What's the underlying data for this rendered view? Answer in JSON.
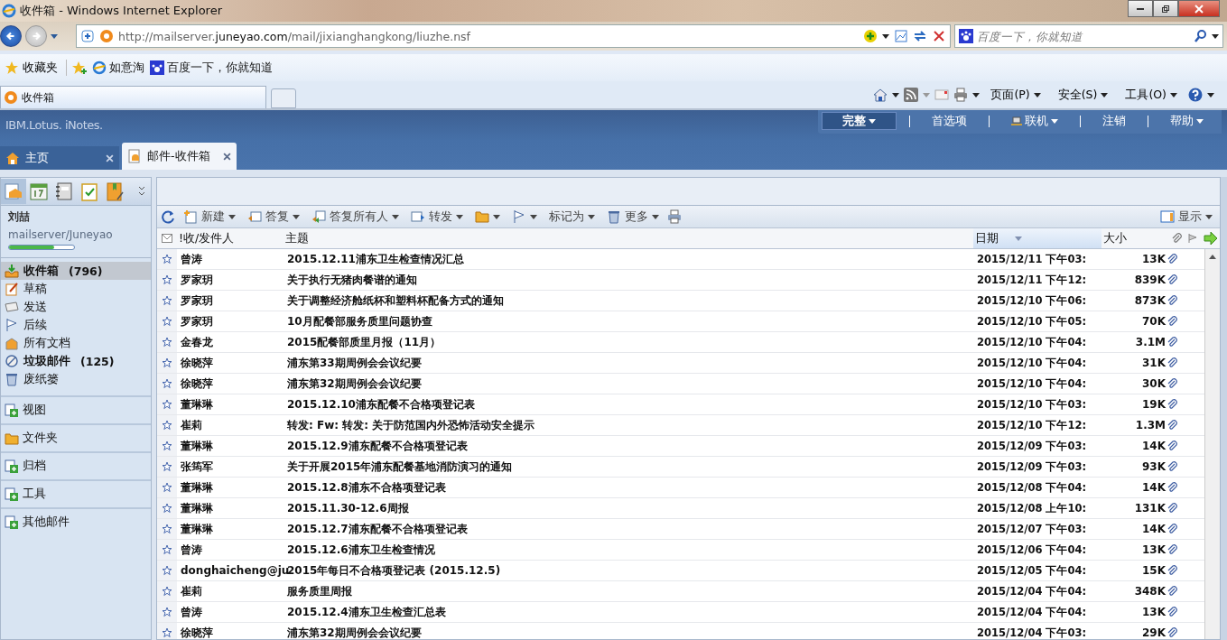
{
  "window": {
    "title": "收件箱 - Windows Internet Explorer"
  },
  "address_bar": {
    "url_prefix": "http://mailserver.",
    "url_domain": "juneyao.com",
    "url_path": "/mail/jixianghangkong/liuzhe.nsf"
  },
  "search": {
    "placeholder": "百度一下，你就知道"
  },
  "favorites_bar": {
    "favorites": "收藏夹",
    "links": [
      "如意淘",
      "百度一下，你就知道"
    ]
  },
  "browser_tabs": [
    {
      "label": "收件箱",
      "selected": true
    }
  ],
  "command_bar": [
    "页面(P)",
    "安全(S)",
    "工具(O)"
  ],
  "app": {
    "logo": "IBM.Lotus. iNotes.",
    "nav": [
      {
        "label": "完整",
        "selected": true,
        "dropdown": true
      },
      {
        "label": "首选项",
        "selected": false,
        "dropdown": false
      },
      {
        "label": "联机",
        "selected": false,
        "dropdown": true
      },
      {
        "label": "注销",
        "selected": false,
        "dropdown": false
      },
      {
        "label": "帮助",
        "selected": false,
        "dropdown": true
      }
    ]
  },
  "app_tabs": [
    {
      "label": "主页",
      "selected": false
    },
    {
      "label": "邮件-收件箱",
      "selected": true
    }
  ],
  "sidebar": {
    "user": "刘喆",
    "server": "mailserver/Juneyao",
    "quota": {
      "level": 0.7
    },
    "folders": [
      {
        "label": "收件箱",
        "count": "(796)",
        "selected": true
      },
      {
        "label": "草稿",
        "selected": false
      },
      {
        "label": "发送",
        "selected": false
      },
      {
        "label": "后续",
        "selected": false
      },
      {
        "label": "所有文档",
        "selected": false
      },
      {
        "label": "垃圾邮件",
        "count": "(125)",
        "selected": false
      },
      {
        "label": "废纸篓",
        "selected": false
      }
    ],
    "sections": [
      "视图",
      "文件夹",
      "归档",
      "工具",
      "其他邮件"
    ]
  },
  "toolbar": {
    "new": "新建",
    "reply": "答复",
    "reply_all": "答复所有人",
    "forward": "转发",
    "mark_as": "标记为",
    "more": "更多",
    "display": "显示"
  },
  "table": {
    "columns": [
      "!收/发件人",
      "主题",
      "日期",
      "大小"
    ],
    "rows": [
      {
        "from": "曾涛",
        "subject": "2015.12.11浦东卫生检查情况汇总",
        "date": "2015/12/11 下午03:",
        "size": "13K"
      },
      {
        "from": "罗家玥",
        "subject": "关于执行无猪肉餐谱的通知",
        "date": "2015/12/11 下午12:",
        "size": "839K"
      },
      {
        "from": "罗家玥",
        "subject": "关于调整经济舱纸杯和塑料杯配备方式的通知",
        "date": "2015/12/10 下午06:",
        "size": "873K"
      },
      {
        "from": "罗家玥",
        "subject": "10月配餐部服务质里问题协查",
        "date": "2015/12/10 下午05:",
        "size": "70K"
      },
      {
        "from": "金春龙",
        "subject": "2015配餐部质里月报（11月）",
        "date": "2015/12/10 下午04:",
        "size": "3.1M"
      },
      {
        "from": "徐晓萍",
        "subject": "浦东第33期周例会会议纪要",
        "date": "2015/12/10 下午04:",
        "size": "31K"
      },
      {
        "from": "徐晓萍",
        "subject": "浦东第32期周例会会议纪要",
        "date": "2015/12/10 下午04:",
        "size": "30K"
      },
      {
        "from": "董琳琳",
        "subject": "2015.12.10浦东配餐不合格项登记表",
        "date": "2015/12/10 下午03:",
        "size": "19K"
      },
      {
        "from": "崔莉",
        "subject": "转发: Fw: 转发: 关于防范国内外恐怖活动安全提示",
        "date": "2015/12/10 下午12:",
        "size": "1.3M"
      },
      {
        "from": "董琳琳",
        "subject": "2015.12.9浦东配餐不合格项登记表",
        "date": "2015/12/09 下午03:",
        "size": "14K"
      },
      {
        "from": "张筠军",
        "subject": "关于开展2015年浦东配餐基地消防演习的通知",
        "date": "2015/12/09 下午03:",
        "size": "93K"
      },
      {
        "from": "董琳琳",
        "subject": "2015.12.8浦东不合格项登记表",
        "date": "2015/12/08 下午04:",
        "size": "14K"
      },
      {
        "from": "董琳琳",
        "subject": "2015.11.30-12.6周报",
        "date": "2015/12/08 上午10:",
        "size": "131K"
      },
      {
        "from": "董琳琳",
        "subject": "2015.12.7浦东配餐不合格项登记表",
        "date": "2015/12/07 下午03:",
        "size": "14K"
      },
      {
        "from": "曾涛",
        "subject": "2015.12.6浦东卫生检查情况",
        "date": "2015/12/06 下午04:",
        "size": "13K"
      },
      {
        "from": "donghaicheng@ju",
        "subject": "2015年每日不合格项登记表 (2015.12.5)",
        "date": "2015/12/05 下午04:",
        "size": "15K"
      },
      {
        "from": "崔莉",
        "subject": "服务质里周报",
        "date": "2015/12/04 下午04:",
        "size": "348K"
      },
      {
        "from": "曾涛",
        "subject": "2015.12.4浦东卫生检查汇总表",
        "date": "2015/12/04 下午04:",
        "size": "13K"
      },
      {
        "from": "徐晓萍",
        "subject": "浦东第32期周例会会议纪要",
        "date": "2015/12/04 下午03:",
        "size": "29K"
      }
    ]
  }
}
